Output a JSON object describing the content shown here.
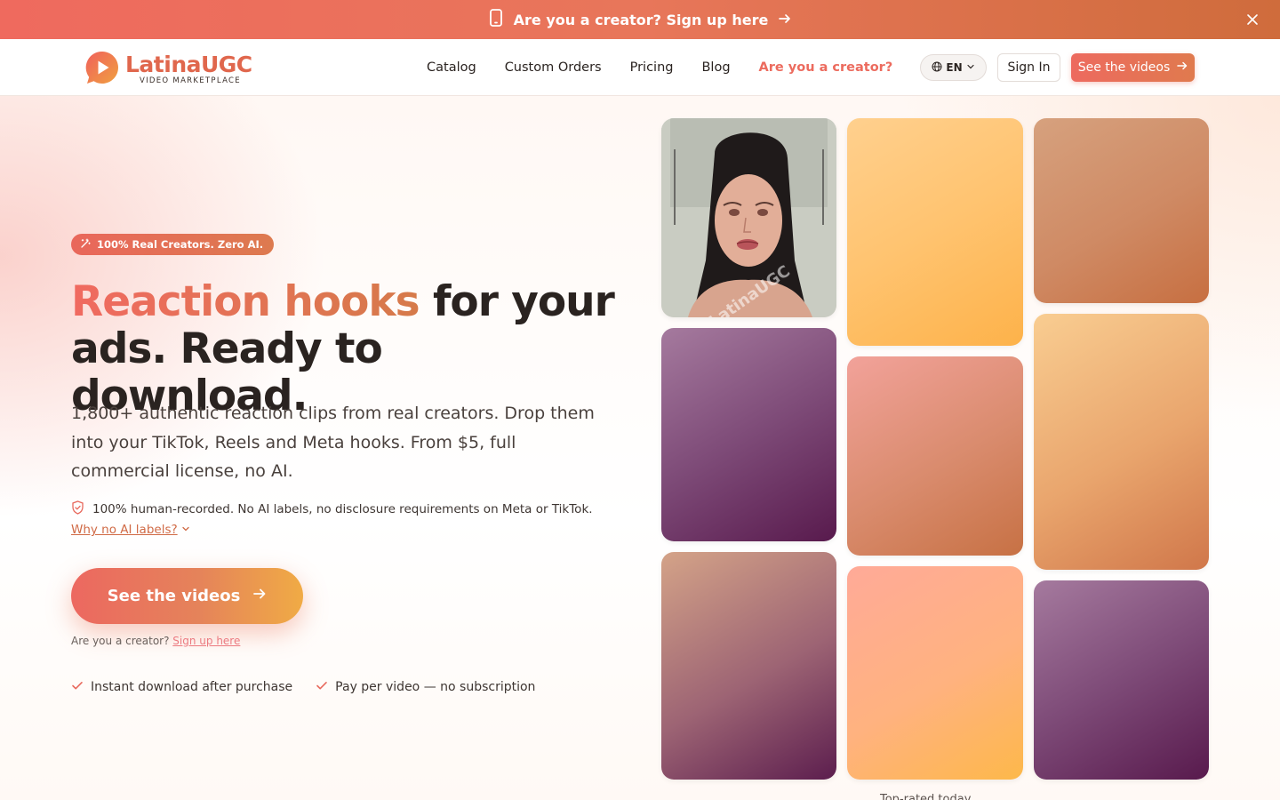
{
  "announcement": {
    "text": "Are you a creator? Sign up here"
  },
  "header": {
    "logo": {
      "name": "LatinaUGC",
      "tagline": "VIDEO MARKETPLACE"
    },
    "nav": [
      "Catalog",
      "Custom Orders",
      "Pricing",
      "Blog",
      "Are you a creator?"
    ],
    "language": "EN",
    "signin_label": "Sign In",
    "cta_label": "See the videos"
  },
  "hero": {
    "badge": "100% Real Creators. Zero AI.",
    "headline_accent": "Reaction hooks",
    "headline_rest": " for your ads. Ready to download.",
    "lead": "1,800+ authentic reaction clips from real creators. Drop them into your TikTok, Reels and Meta hooks. From $5, full commercial license, no AI.",
    "ai_note": "100% human-recorded. No AI labels, no disclosure requirements on Meta or TikTok.",
    "why_link": "Why no AI labels?",
    "cta_label": "See the videos",
    "creator_prompt": "Are you a creator?",
    "creator_link": "Sign up here",
    "perks": [
      "Instant download after purchase",
      "Pay per video — no subscription"
    ]
  },
  "grid": {
    "watermark": "LatinaUGC",
    "caption_peek": "Top-rated today"
  },
  "colors": {
    "brand_coral": "#ec6b5e",
    "brand_orange": "#e07a4e",
    "text_dark": "#2a2320"
  }
}
